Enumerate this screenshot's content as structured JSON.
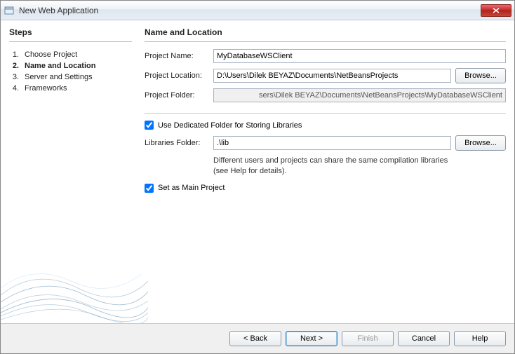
{
  "window": {
    "title": "New Web Application"
  },
  "steps": {
    "heading": "Steps",
    "items": [
      {
        "num": "1.",
        "label": "Choose Project"
      },
      {
        "num": "2.",
        "label": "Name and Location"
      },
      {
        "num": "3.",
        "label": "Server and Settings"
      },
      {
        "num": "4.",
        "label": "Frameworks"
      }
    ],
    "active_index": 1
  },
  "main": {
    "heading": "Name and Location",
    "project_name_label": "Project Name:",
    "project_name_value": "MyDatabaseWSClient",
    "project_location_label": "Project Location:",
    "project_location_value": "D:\\Users\\Dilek BEYAZ\\Documents\\NetBeansProjects",
    "project_folder_label": "Project Folder:",
    "project_folder_value": "sers\\Dilek BEYAZ\\Documents\\NetBeansProjects\\MyDatabaseWSClient",
    "browse_label": "Browse...",
    "use_dedicated_label": "Use Dedicated Folder for Storing Libraries",
    "use_dedicated_checked": true,
    "libraries_folder_label": "Libraries Folder:",
    "libraries_folder_value": ".\\lib",
    "hint_line1": "Different users and projects can share the same compilation libraries",
    "hint_line2": "(see Help for details).",
    "set_main_label": "Set as Main Project",
    "set_main_checked": true
  },
  "footer": {
    "back": "< Back",
    "next": "Next >",
    "finish": "Finish",
    "cancel": "Cancel",
    "help": "Help"
  }
}
